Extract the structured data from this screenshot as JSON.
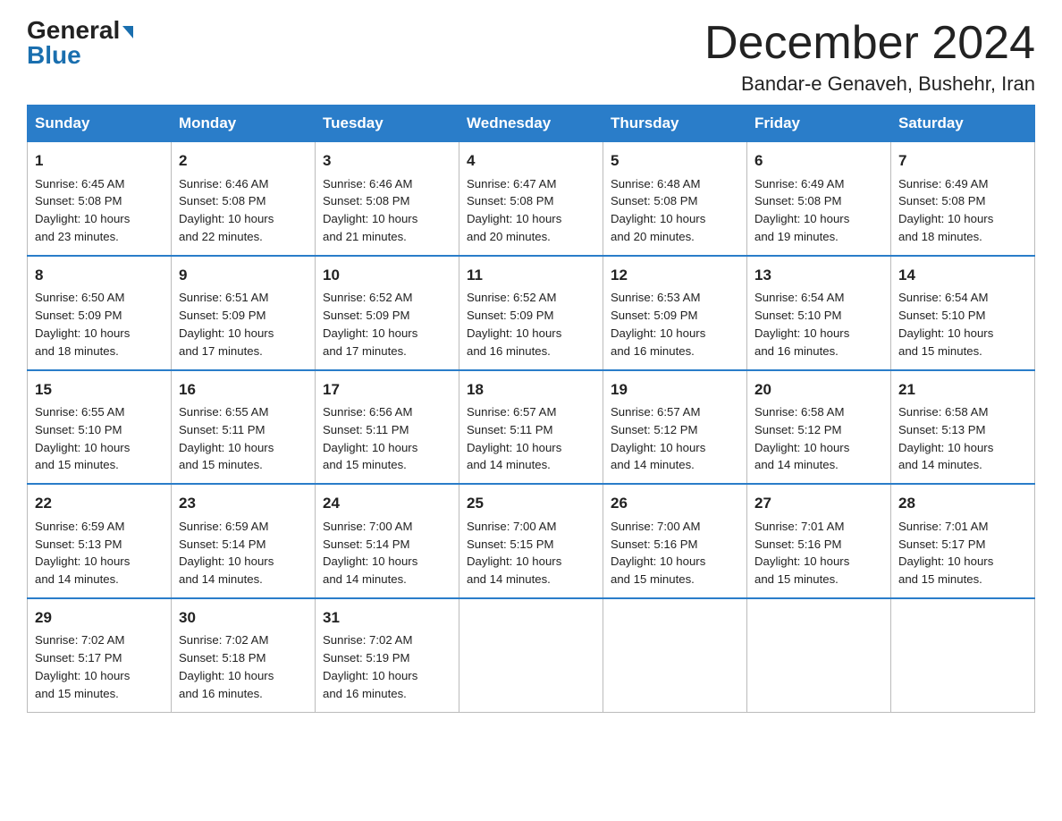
{
  "header": {
    "logo_general": "General",
    "logo_blue": "Blue",
    "month_title": "December 2024",
    "subtitle": "Bandar-e Genaveh, Bushehr, Iran"
  },
  "days_of_week": [
    "Sunday",
    "Monday",
    "Tuesday",
    "Wednesday",
    "Thursday",
    "Friday",
    "Saturday"
  ],
  "weeks": [
    [
      {
        "day": "1",
        "sunrise": "6:45 AM",
        "sunset": "5:08 PM",
        "daylight": "10 hours and 23 minutes."
      },
      {
        "day": "2",
        "sunrise": "6:46 AM",
        "sunset": "5:08 PM",
        "daylight": "10 hours and 22 minutes."
      },
      {
        "day": "3",
        "sunrise": "6:46 AM",
        "sunset": "5:08 PM",
        "daylight": "10 hours and 21 minutes."
      },
      {
        "day": "4",
        "sunrise": "6:47 AM",
        "sunset": "5:08 PM",
        "daylight": "10 hours and 20 minutes."
      },
      {
        "day": "5",
        "sunrise": "6:48 AM",
        "sunset": "5:08 PM",
        "daylight": "10 hours and 20 minutes."
      },
      {
        "day": "6",
        "sunrise": "6:49 AM",
        "sunset": "5:08 PM",
        "daylight": "10 hours and 19 minutes."
      },
      {
        "day": "7",
        "sunrise": "6:49 AM",
        "sunset": "5:08 PM",
        "daylight": "10 hours and 18 minutes."
      }
    ],
    [
      {
        "day": "8",
        "sunrise": "6:50 AM",
        "sunset": "5:09 PM",
        "daylight": "10 hours and 18 minutes."
      },
      {
        "day": "9",
        "sunrise": "6:51 AM",
        "sunset": "5:09 PM",
        "daylight": "10 hours and 17 minutes."
      },
      {
        "day": "10",
        "sunrise": "6:52 AM",
        "sunset": "5:09 PM",
        "daylight": "10 hours and 17 minutes."
      },
      {
        "day": "11",
        "sunrise": "6:52 AM",
        "sunset": "5:09 PM",
        "daylight": "10 hours and 16 minutes."
      },
      {
        "day": "12",
        "sunrise": "6:53 AM",
        "sunset": "5:09 PM",
        "daylight": "10 hours and 16 minutes."
      },
      {
        "day": "13",
        "sunrise": "6:54 AM",
        "sunset": "5:10 PM",
        "daylight": "10 hours and 16 minutes."
      },
      {
        "day": "14",
        "sunrise": "6:54 AM",
        "sunset": "5:10 PM",
        "daylight": "10 hours and 15 minutes."
      }
    ],
    [
      {
        "day": "15",
        "sunrise": "6:55 AM",
        "sunset": "5:10 PM",
        "daylight": "10 hours and 15 minutes."
      },
      {
        "day": "16",
        "sunrise": "6:55 AM",
        "sunset": "5:11 PM",
        "daylight": "10 hours and 15 minutes."
      },
      {
        "day": "17",
        "sunrise": "6:56 AM",
        "sunset": "5:11 PM",
        "daylight": "10 hours and 15 minutes."
      },
      {
        "day": "18",
        "sunrise": "6:57 AM",
        "sunset": "5:11 PM",
        "daylight": "10 hours and 14 minutes."
      },
      {
        "day": "19",
        "sunrise": "6:57 AM",
        "sunset": "5:12 PM",
        "daylight": "10 hours and 14 minutes."
      },
      {
        "day": "20",
        "sunrise": "6:58 AM",
        "sunset": "5:12 PM",
        "daylight": "10 hours and 14 minutes."
      },
      {
        "day": "21",
        "sunrise": "6:58 AM",
        "sunset": "5:13 PM",
        "daylight": "10 hours and 14 minutes."
      }
    ],
    [
      {
        "day": "22",
        "sunrise": "6:59 AM",
        "sunset": "5:13 PM",
        "daylight": "10 hours and 14 minutes."
      },
      {
        "day": "23",
        "sunrise": "6:59 AM",
        "sunset": "5:14 PM",
        "daylight": "10 hours and 14 minutes."
      },
      {
        "day": "24",
        "sunrise": "7:00 AM",
        "sunset": "5:14 PM",
        "daylight": "10 hours and 14 minutes."
      },
      {
        "day": "25",
        "sunrise": "7:00 AM",
        "sunset": "5:15 PM",
        "daylight": "10 hours and 14 minutes."
      },
      {
        "day": "26",
        "sunrise": "7:00 AM",
        "sunset": "5:16 PM",
        "daylight": "10 hours and 15 minutes."
      },
      {
        "day": "27",
        "sunrise": "7:01 AM",
        "sunset": "5:16 PM",
        "daylight": "10 hours and 15 minutes."
      },
      {
        "day": "28",
        "sunrise": "7:01 AM",
        "sunset": "5:17 PM",
        "daylight": "10 hours and 15 minutes."
      }
    ],
    [
      {
        "day": "29",
        "sunrise": "7:02 AM",
        "sunset": "5:17 PM",
        "daylight": "10 hours and 15 minutes."
      },
      {
        "day": "30",
        "sunrise": "7:02 AM",
        "sunset": "5:18 PM",
        "daylight": "10 hours and 16 minutes."
      },
      {
        "day": "31",
        "sunrise": "7:02 AM",
        "sunset": "5:19 PM",
        "daylight": "10 hours and 16 minutes."
      },
      null,
      null,
      null,
      null
    ]
  ],
  "labels": {
    "sunrise": "Sunrise:",
    "sunset": "Sunset:",
    "daylight": "Daylight:"
  }
}
